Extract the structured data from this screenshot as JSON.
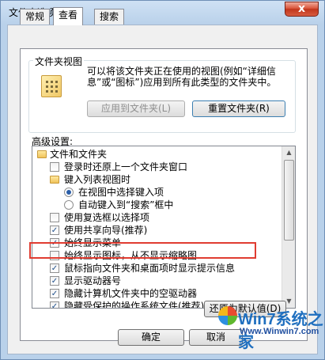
{
  "window": {
    "title": "文件夹选项",
    "close_glyph": "x"
  },
  "tabs": [
    {
      "label": "常规",
      "active": false
    },
    {
      "label": "查看",
      "active": true
    },
    {
      "label": "搜索",
      "active": false
    }
  ],
  "folder_views": {
    "group_label": "文件夹视图",
    "description": "可以将该文件夹正在使用的视图(例如“详细信息”或“图标”)应用到所有此类型的文件夹中。",
    "apply_label": "应用到文件夹(L)",
    "reset_label": "重置文件夹(R)"
  },
  "advanced": {
    "label": "高级设置:",
    "items": [
      {
        "kind": "folder",
        "label": "文件和文件夹"
      },
      {
        "kind": "checkbox",
        "label": "登录时还原上一个文件夹窗口",
        "checked": false
      },
      {
        "kind": "folder",
        "label": "键入列表视图时"
      },
      {
        "kind": "radio",
        "label": "在视图中选择键入项",
        "checked": true
      },
      {
        "kind": "radio",
        "label": "自动键入到“搜索”框中",
        "checked": false
      },
      {
        "kind": "checkbox",
        "label": "使用复选框以选择项",
        "checked": false
      },
      {
        "kind": "checkbox",
        "label": "使用共享向导(推荐)",
        "checked": true
      },
      {
        "kind": "checkbox",
        "label": "始终显示菜单",
        "checked": true
      },
      {
        "kind": "checkbox",
        "label": "始终显示图标，从不显示缩略图",
        "checked": false
      },
      {
        "kind": "checkbox",
        "label": "鼠标指向文件夹和桌面项时显示提示信息",
        "checked": true
      },
      {
        "kind": "checkbox",
        "label": "显示驱动器号",
        "checked": true
      },
      {
        "kind": "checkbox",
        "label": "隐藏计算机文件夹中的空驱动器",
        "checked": true
      },
      {
        "kind": "checkbox",
        "label": "隐藏受保护的操作系统文件(推荐)",
        "checked": true
      }
    ],
    "restore_defaults_label": "还原为默认值(D)"
  },
  "footer": {
    "ok_label": "确定",
    "cancel_label": "取消"
  },
  "watermark": {
    "brand": "Win7系统之家",
    "url": "Www.Winwin7.com"
  }
}
